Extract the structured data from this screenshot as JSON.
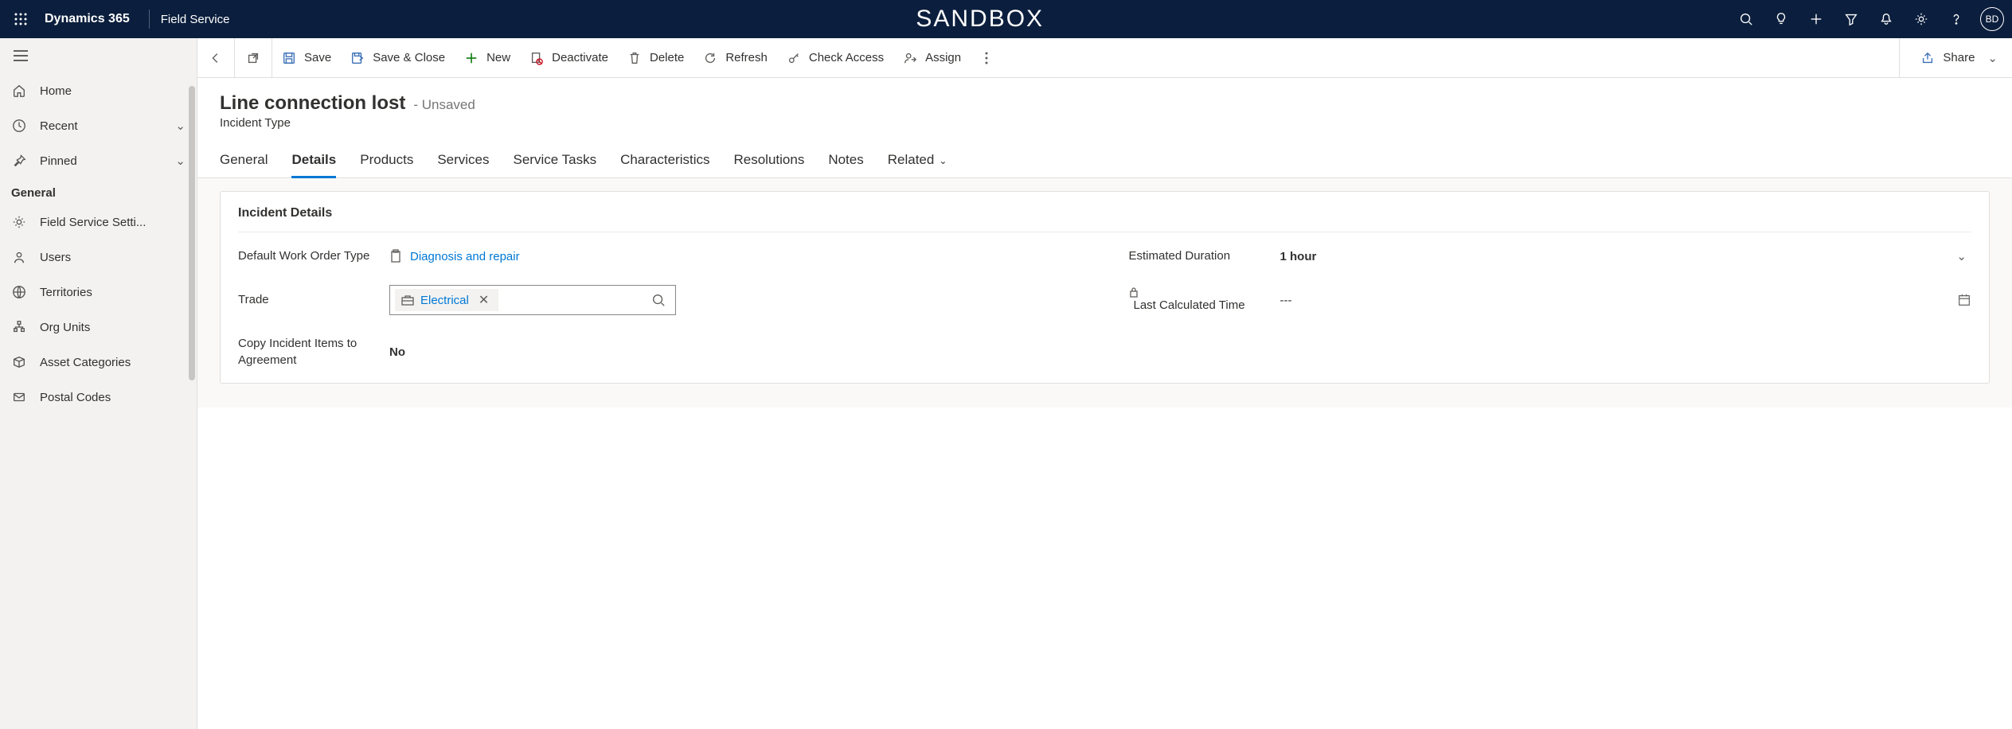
{
  "topbar": {
    "brand": "Dynamics 365",
    "app": "Field Service",
    "env": "SANDBOX",
    "avatar": "BD"
  },
  "sidebar": {
    "home": "Home",
    "recent": "Recent",
    "pinned": "Pinned",
    "group_general": "General",
    "items": [
      "Field Service Setti...",
      "Users",
      "Territories",
      "Org Units",
      "Asset Categories",
      "Postal Codes"
    ]
  },
  "cmd": {
    "save": "Save",
    "save_close": "Save & Close",
    "new": "New",
    "deactivate": "Deactivate",
    "delete": "Delete",
    "refresh": "Refresh",
    "check_access": "Check Access",
    "assign": "Assign",
    "share": "Share"
  },
  "header": {
    "title": "Line connection lost",
    "unsaved": "- Unsaved",
    "subtitle": "Incident Type"
  },
  "tabs": [
    "General",
    "Details",
    "Products",
    "Services",
    "Service Tasks",
    "Characteristics",
    "Resolutions",
    "Notes",
    "Related"
  ],
  "section_title": "Incident Details",
  "fields": {
    "default_wo_type_label": "Default Work Order Type",
    "default_wo_type_value": "Diagnosis and repair",
    "estimated_duration_label": "Estimated Duration",
    "estimated_duration_value": "1 hour",
    "trade_label": "Trade",
    "trade_value": "Electrical",
    "last_calc_label": "Last Calculated Time",
    "last_calc_value": "---",
    "copy_items_label": "Copy Incident Items to Agreement",
    "copy_items_value": "No"
  }
}
